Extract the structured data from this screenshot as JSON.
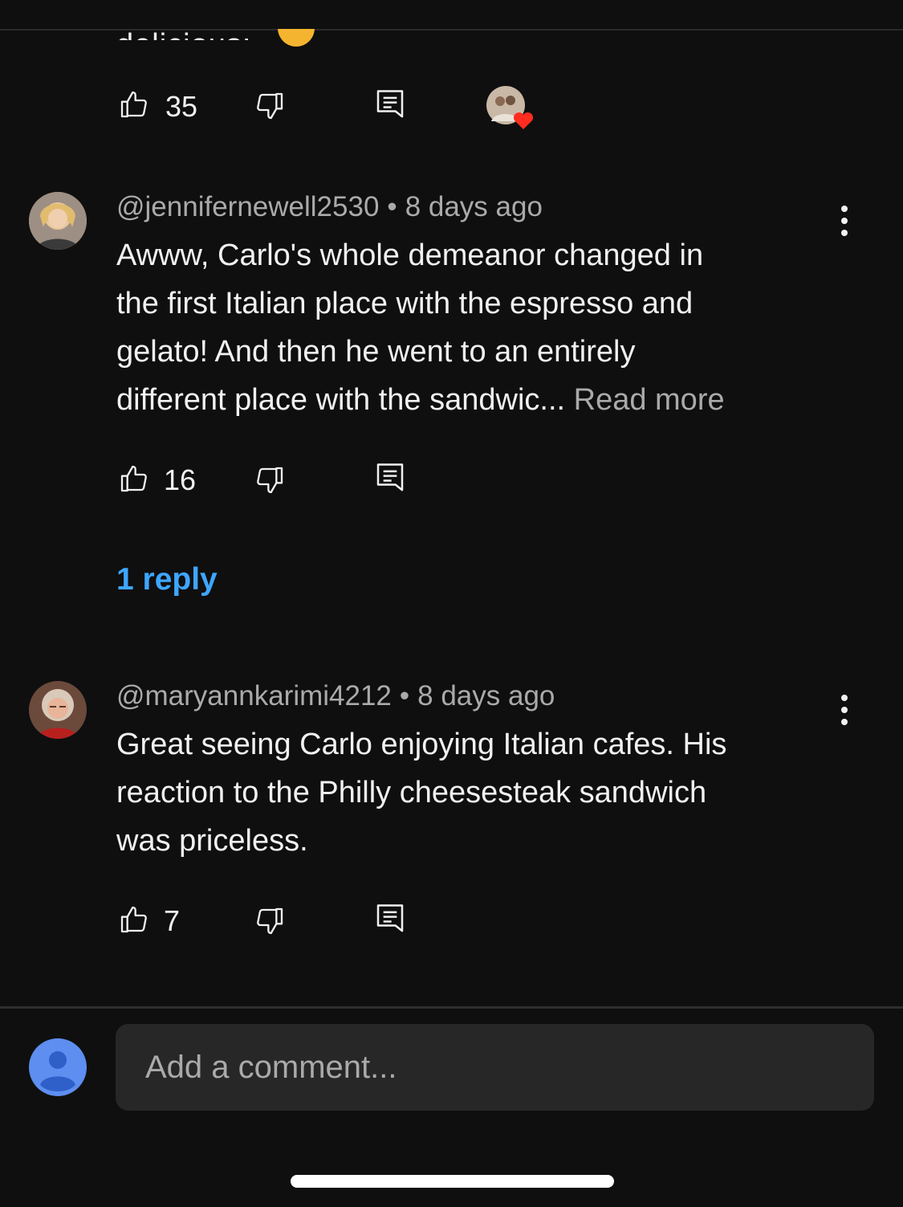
{
  "previous_comment": {
    "cut_text": "delicious:",
    "likes": "35"
  },
  "comments": [
    {
      "handle": "@jennifernewell2530",
      "separator": "•",
      "time": "8 days ago",
      "lines": [
        "Awww, Carlo's whole demeanor changed in",
        "the first Italian place with the espresso and",
        "gelato! And then he went to an entirely",
        "different place with the sandwic..."
      ],
      "read_more": "Read more",
      "likes": "16",
      "replies_label": "1 reply"
    },
    {
      "handle": "@maryannkarimi4212",
      "separator": "•",
      "time": "8 days ago",
      "lines": [
        "Great seeing Carlo enjoying Italian cafes. His",
        "reaction to the Philly cheesesteak sandwich",
        "was priceless."
      ],
      "likes": "7"
    }
  ],
  "composer": {
    "placeholder": "Add a comment..."
  },
  "icons": {
    "like": "thumbs-up-icon",
    "dislike": "thumbs-down-icon",
    "reply": "reply-comment-icon",
    "more": "more-vert-icon",
    "creator_heart": "creator-heart-badge",
    "account": "account-icon"
  },
  "colors": {
    "background": "#0f0f0f",
    "text": "#f1f1f1",
    "secondary_text": "#aaaaaa",
    "link": "#3ea6ff",
    "input_background": "#272727",
    "avatar_default": "#5d8ef0"
  }
}
